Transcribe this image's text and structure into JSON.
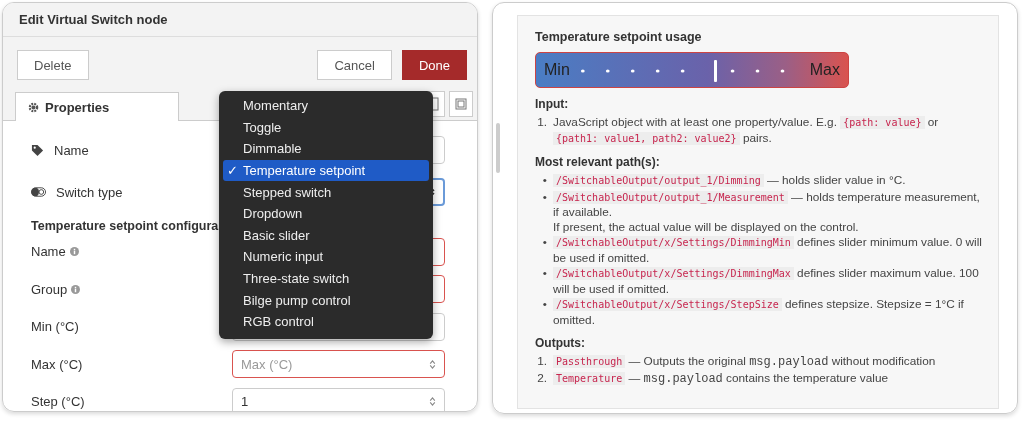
{
  "dialog": {
    "title": "Edit Virtual Switch node",
    "buttons_left": [
      {
        "label": "Delete",
        "kind": "plain"
      }
    ],
    "buttons_right": [
      {
        "label": "Cancel",
        "kind": "plain"
      },
      {
        "label": "Done",
        "kind": "primary"
      }
    ],
    "tabs": [
      {
        "label": "Properties",
        "selected": true
      }
    ],
    "properties": [
      {
        "label": "Name"
      },
      {
        "label": "Switch type"
      }
    ],
    "config": {
      "heading": "Temperature setpoint configura",
      "fields": [
        {
          "label": "Name",
          "info": true,
          "invalid": true
        },
        {
          "label": "Group",
          "info": true,
          "invalid": true
        },
        {
          "label": "Min (°C)",
          "info": false,
          "invalid": false
        },
        {
          "label": "Max (°C)",
          "info": false,
          "invalid": true,
          "placeholder": "Max (°C)"
        },
        {
          "label": "Step (°C)",
          "info": false,
          "invalid": false,
          "value": "1"
        }
      ]
    },
    "dropdown": {
      "check_mark": "✓",
      "items": [
        {
          "label": "Momentary",
          "selected": false
        },
        {
          "label": "Toggle",
          "selected": false
        },
        {
          "label": "Dimmable",
          "selected": false
        },
        {
          "label": "Temperature setpoint",
          "selected": true
        },
        {
          "label": "Stepped switch",
          "selected": false
        },
        {
          "label": "Dropdown",
          "selected": false
        },
        {
          "label": "Basic slider",
          "selected": false
        },
        {
          "label": "Numeric input",
          "selected": false
        },
        {
          "label": "Three-state switch",
          "selected": false
        },
        {
          "label": "Bilge pump control",
          "selected": false
        },
        {
          "label": "RGB control",
          "selected": false
        }
      ]
    }
  },
  "help": {
    "title": "Temperature setpoint usage",
    "slider": {
      "min_label": "Min",
      "max_label": "Max",
      "level": 0.57
    },
    "sections": [
      {
        "heading": "Input:",
        "markers": [
          "1."
        ],
        "items": [
          [
            {
              "kind": "text",
              "text": "JavaScript object with at least one property/value. E.g. "
            },
            {
              "kind": "code",
              "text": "{path: value}"
            },
            {
              "kind": "text",
              "text": " or "
            },
            {
              "kind": "code",
              "text": "{path1: value1, path2: value2}"
            },
            {
              "kind": "text",
              "text": " pairs."
            }
          ]
        ]
      },
      {
        "heading": "Most relevant path(s):",
        "markers": [
          "•",
          "•",
          "•",
          "•",
          "•"
        ],
        "items": [
          [
            {
              "kind": "code",
              "text": "/SwitchableOutput/output_1/Dimming"
            },
            {
              "kind": "text",
              "text": " — holds slider value in °C."
            }
          ],
          [
            {
              "kind": "code",
              "text": "/SwitchableOutput/output_1/Measurement"
            },
            {
              "kind": "text",
              "text": " — holds temperature measurement, if available."
            },
            {
              "kind": "break"
            },
            {
              "kind": "text",
              "text": "If present, the actual value will be displayed on the control."
            }
          ],
          [
            {
              "kind": "code",
              "text": "/SwitchableOutput/x/Settings/DimmingMin"
            },
            {
              "kind": "text",
              "text": " defines slider minimum value. 0 will be used if omitted."
            }
          ],
          [
            {
              "kind": "code",
              "text": "/SwitchableOutput/x/Settings/DimmingMax"
            },
            {
              "kind": "text",
              "text": " defines slider maximum value. 100 will be used if omitted."
            }
          ],
          [
            {
              "kind": "code",
              "text": "/SwitchableOutput/x/Settings/StepSize"
            },
            {
              "kind": "text",
              "text": " defines stepsize. Stepsize = 1°C if omitted."
            }
          ]
        ]
      },
      {
        "heading": "Outputs:",
        "markers": [
          "1.",
          "2."
        ],
        "items": [
          [
            {
              "kind": "code",
              "text": "Passthrough"
            },
            {
              "kind": "text",
              "text": " — Outputs the original "
            },
            {
              "kind": "mono",
              "text": "msg.payload"
            },
            {
              "kind": "text",
              "text": " without modification"
            }
          ],
          [
            {
              "kind": "code",
              "text": "Temperature"
            },
            {
              "kind": "text",
              "text": " — "
            },
            {
              "kind": "mono",
              "text": "msg.payload"
            },
            {
              "kind": "text",
              "text": " contains the temperature value"
            }
          ]
        ]
      }
    ]
  }
}
